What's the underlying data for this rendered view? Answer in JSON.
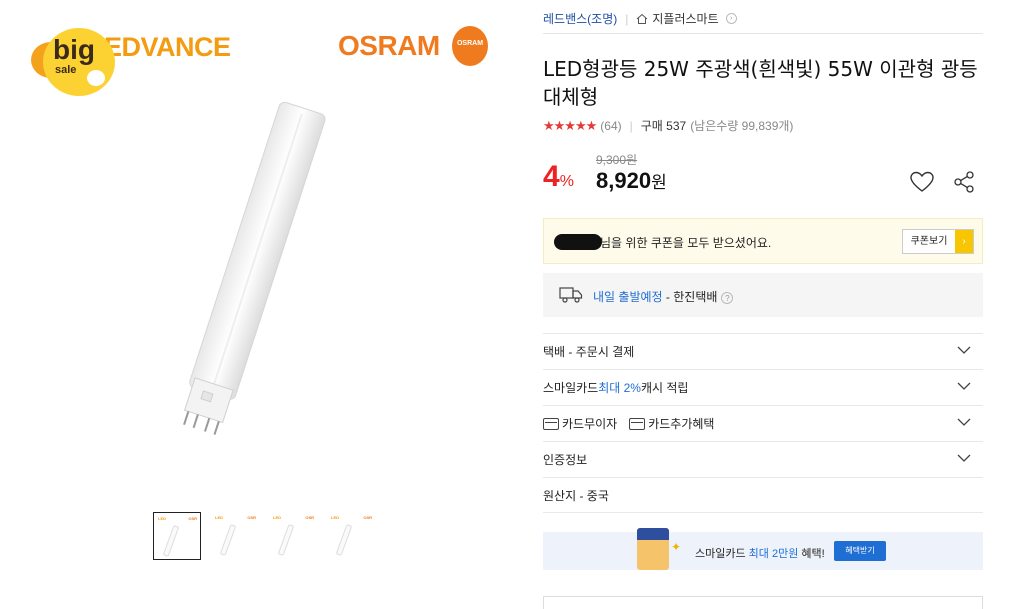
{
  "gallery": {
    "brand_left": "EDVANCE",
    "brand_right": "OSRAM",
    "osram_badge": "OSRAM",
    "bigsale": {
      "big": "big",
      "sale": "sale"
    },
    "thumb_count": 4
  },
  "breadcrumb": {
    "store": "레드밴스(조명)",
    "smart_store": "지플러스마트",
    "home_icon": "home-icon"
  },
  "product": {
    "title": "LED형광등 25W 주광색(흰색빛) 55W 이관형 광등 대체형",
    "stars": "★★★★★",
    "review_count": "(64)",
    "purchase": "구매 537",
    "remaining": "(남은수량 99,839개)",
    "original_price": "9,300원",
    "discount_number": "4",
    "discount_unit": "%",
    "price_number": "8,920",
    "price_unit": "원"
  },
  "coupon": {
    "message": "님을 위한 쿠폰을 모두 받으셨어요.",
    "button": "쿠폰보기",
    "button_arrow": "›"
  },
  "shipping": {
    "schedule": "내일 출발예정",
    "carrier": " - 한진택배",
    "help": "?"
  },
  "rows": [
    {
      "text": "택배 - 주문시 결제",
      "chevron": true
    },
    {
      "pre": "스마일카드 ",
      "blue": "최대 2%",
      "post": " 캐시 적립",
      "chevron": true
    },
    {
      "card1": "카드무이자",
      "card2": "카드추가혜택",
      "chevron": true
    },
    {
      "text": "인증정보",
      "chevron": true
    },
    {
      "text": "원산지 - 중국",
      "chevron": false
    }
  ],
  "banner": {
    "pre": "스마일카드 ",
    "blue": "최대 2만원",
    "post": " 혜택!",
    "button": "혜택받기"
  },
  "colors": {
    "accent_red": "#e22222",
    "link_blue": "#1f6ed4",
    "coupon_bg": "#fffbea",
    "osram_orange": "#f07b1f"
  }
}
